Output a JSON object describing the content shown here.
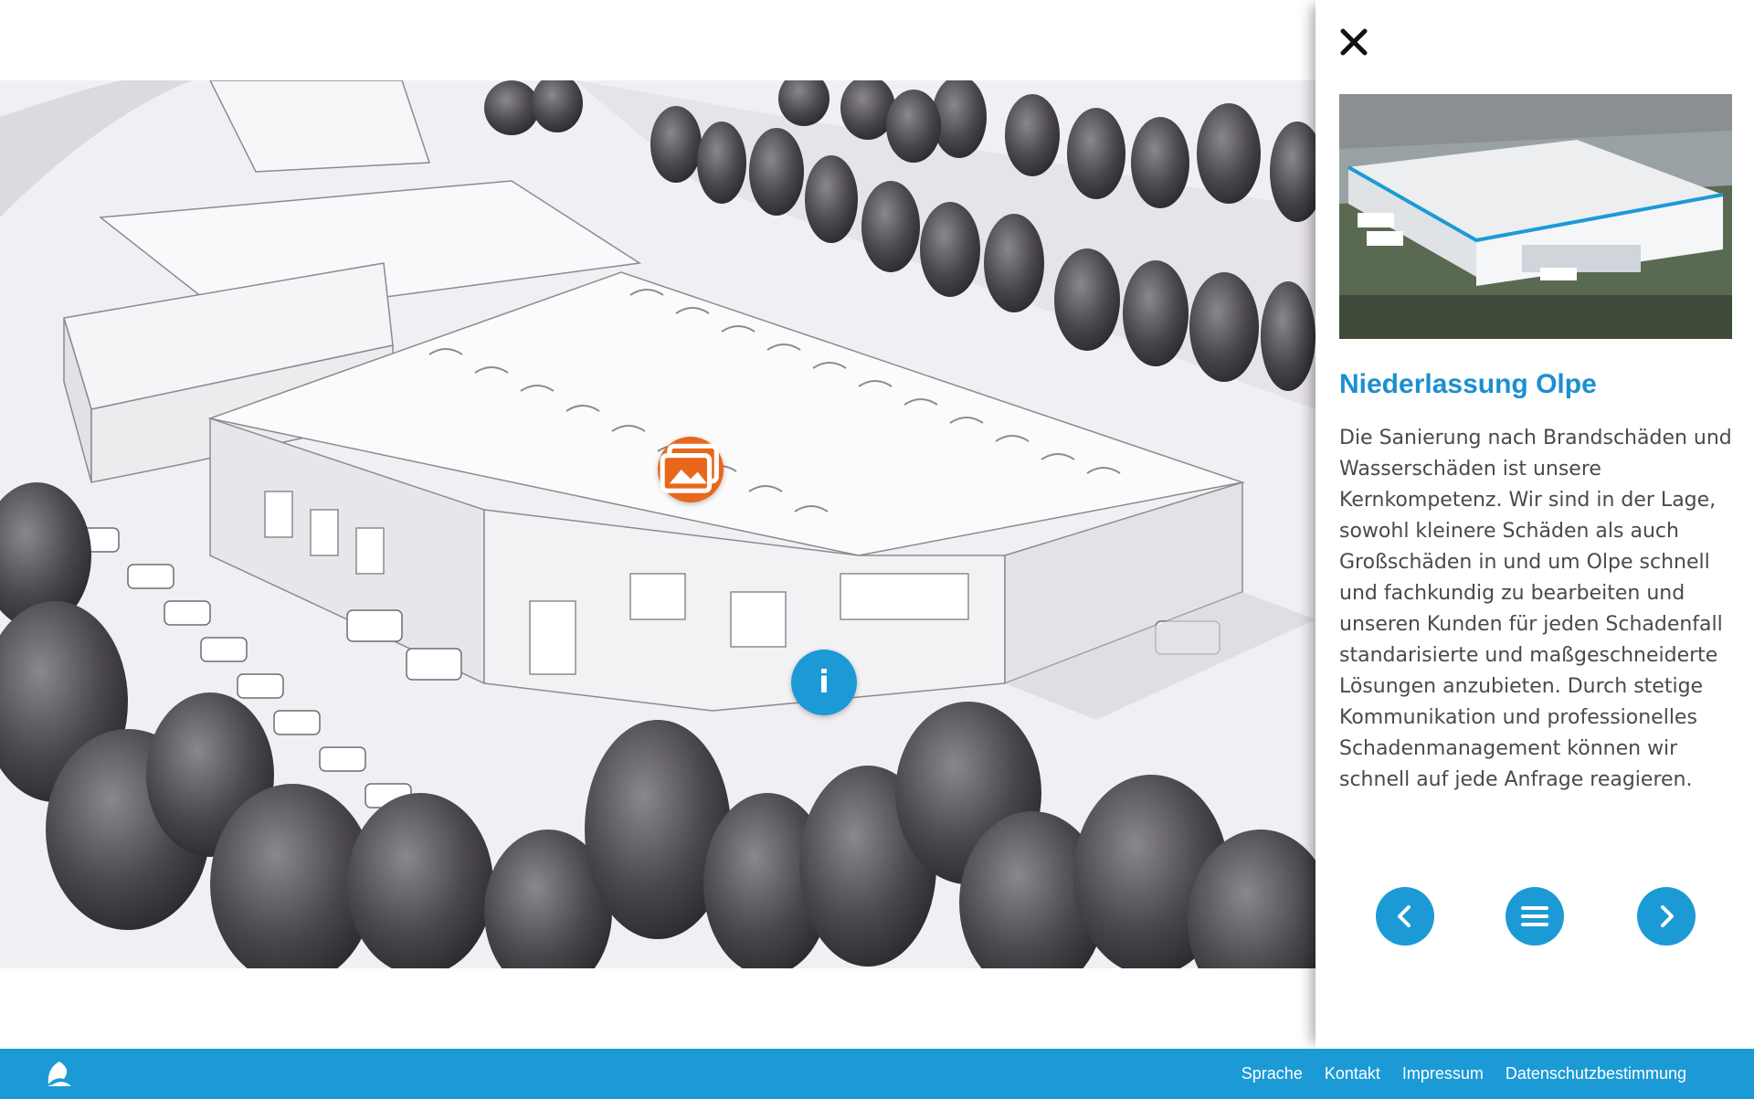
{
  "scene": {
    "hotspots": [
      {
        "kind": "gallery",
        "icon": "image-gallery-icon",
        "color": "#e9671b"
      },
      {
        "kind": "info",
        "label": "i",
        "color": "#1c9ad6"
      }
    ]
  },
  "panel": {
    "close_icon": "close-icon",
    "photo_alt": "Luftbild Niederlassung Olpe",
    "title": "Niederlassung Olpe",
    "body": "Die Sanierung nach Brandschäden und Wasserschäden ist unsere Kernkompetenz. Wir sind in der Lage, sowohl kleinere Schäden als auch Großschäden in und um Olpe schnell und fachkundig zu bearbeiten und unseren Kunden für jeden Schadenfall standarisierte und maßgeschneiderte Lösungen anzubieten. Durch stetige Kommunikation und professionelles Schadenmanagement können wir schnell auf jede Anfrage reagieren.",
    "nav": {
      "prev_icon": "chevron-left-icon",
      "menu_icon": "menu-icon",
      "next_icon": "chevron-right-icon"
    }
  },
  "footer": {
    "logo_icon": "brand-logo-icon",
    "links": [
      "Sprache",
      "Kontakt",
      "Impressum",
      "Datenschutzbestimmung"
    ]
  },
  "colors": {
    "accent": "#1c9ad6",
    "title": "#1b8fd0",
    "gallery_hotspot": "#e9671b"
  }
}
